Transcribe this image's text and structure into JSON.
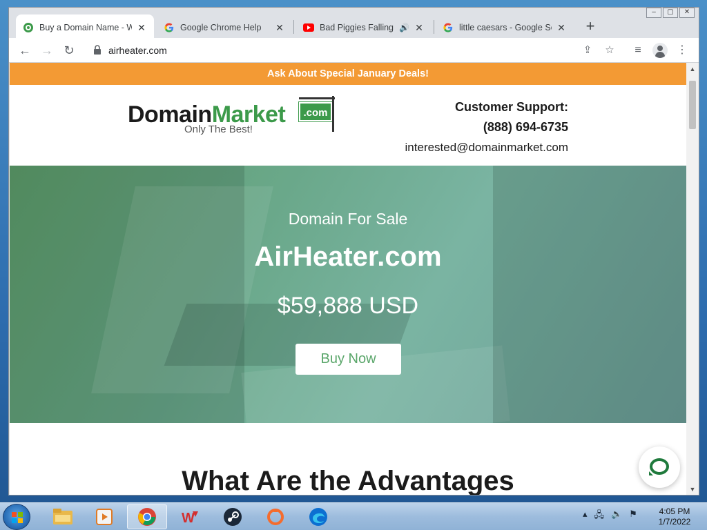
{
  "browser": {
    "tabs": [
      {
        "title": "Buy a Domain Name - Wo",
        "favicon": "domainmarket-favicon",
        "active": true
      },
      {
        "title": "Google Chrome Help",
        "favicon": "google-g-icon",
        "active": false
      },
      {
        "title": "Bad Piggies Falling Of",
        "favicon": "youtube-icon",
        "active": false,
        "audio": true
      },
      {
        "title": "little caesars - Google Sea",
        "favicon": "google-g-icon",
        "active": false
      }
    ],
    "url": "airheater.com"
  },
  "page": {
    "promo": "Ask About Special January Deals!",
    "logo": {
      "domain": "Domain",
      "market": "Market",
      "com": ".com",
      "tagline": "Only The Best!"
    },
    "support": {
      "label": "Customer Support:",
      "phone": "(888) 694-6735",
      "email": "interested@domainmarket.com"
    },
    "hero": {
      "subtitle": "Domain For Sale",
      "domain": "AirHeater.com",
      "price": "$59,888 USD",
      "button": "Buy Now"
    },
    "advantages_title": "What Are the Advantages"
  },
  "taskbar": {
    "apps": [
      "explorer-icon",
      "media-player-icon",
      "chrome-icon",
      "wps-icon",
      "steam-icon",
      "origin-icon",
      "edge-icon"
    ],
    "time": "4:05 PM",
    "date": "1/7/2022"
  },
  "colors": {
    "promo_bg": "#f39a34",
    "brand_green": "#3c9a4a",
    "chat_green": "#1f7a3c"
  }
}
